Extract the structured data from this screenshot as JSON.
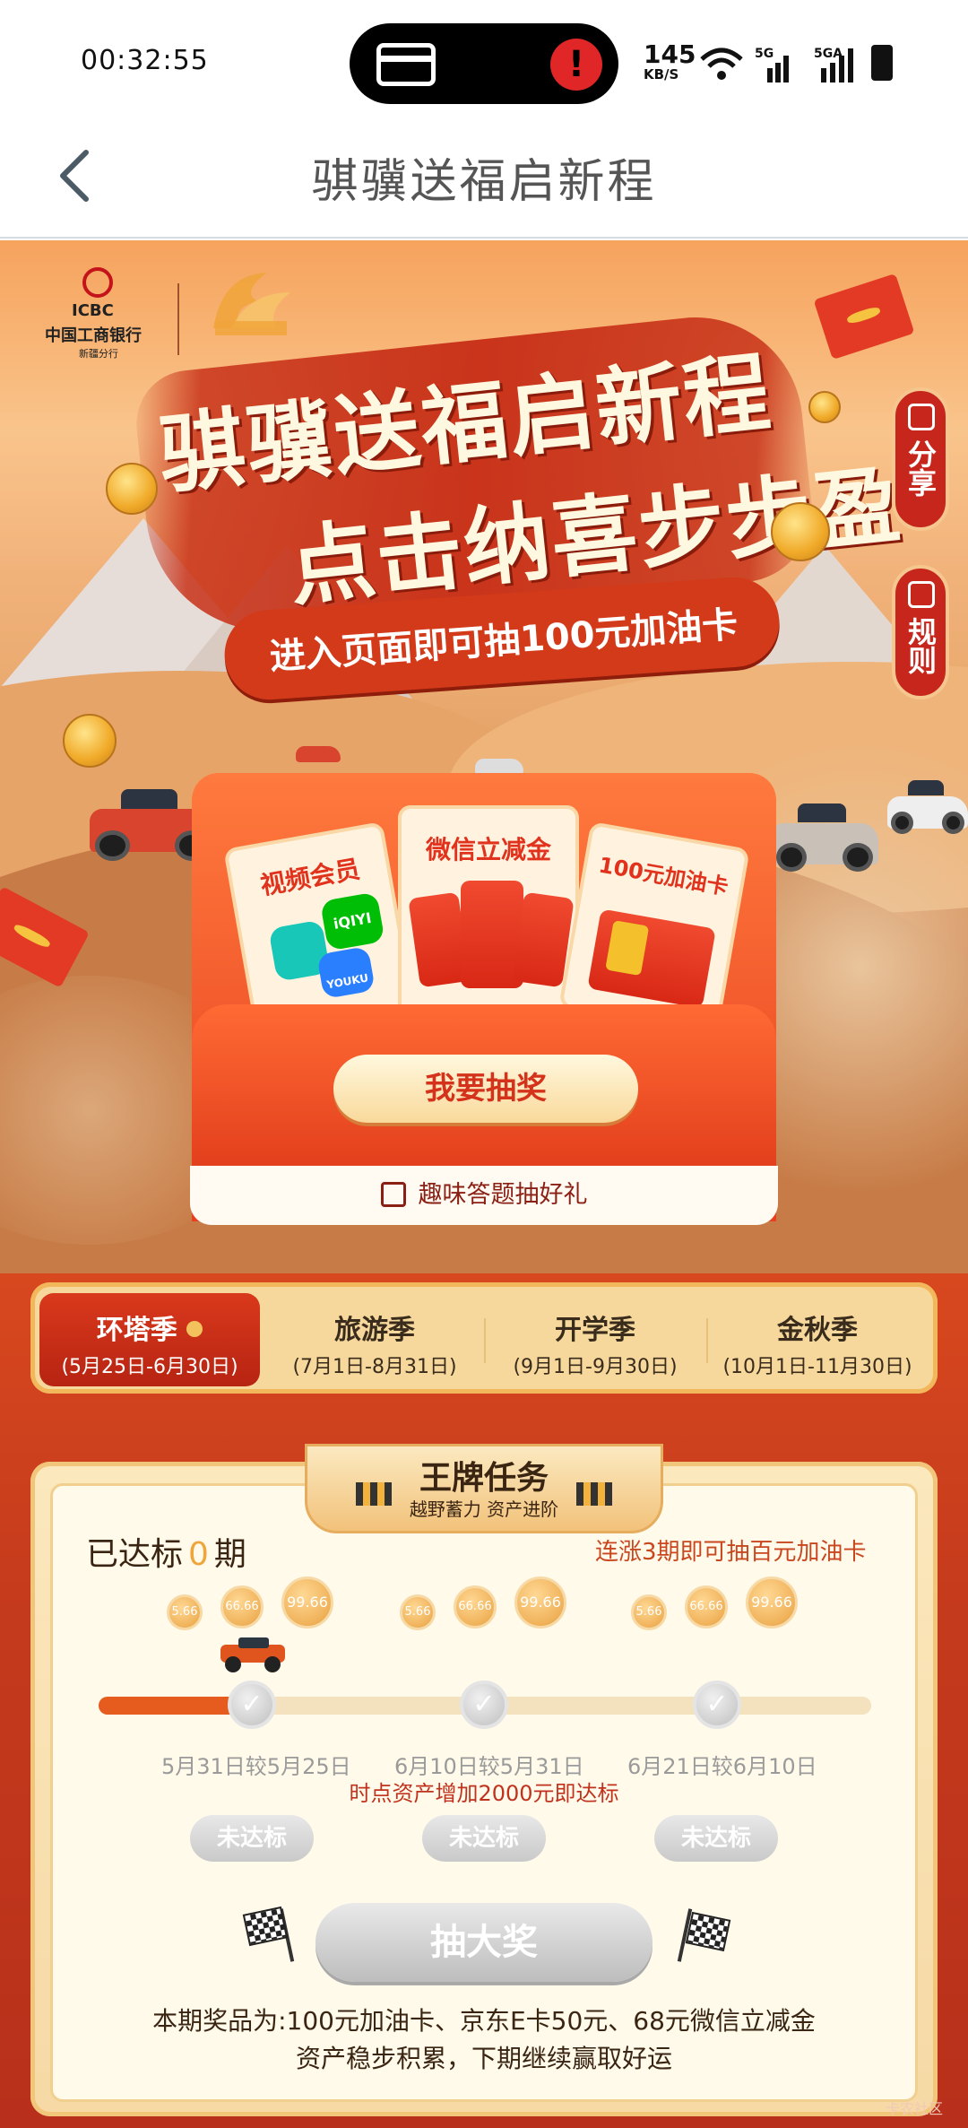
{
  "status": {
    "time": "00:32:55",
    "speed": "145",
    "speed_unit": "KB/S",
    "sig1": "5G",
    "sig2": "5GA"
  },
  "nav": {
    "title": "骐骥送福启新程"
  },
  "hero": {
    "bank_en": "ICBC",
    "bank_cn": "中国工商银行",
    "bank_branch": "新疆分行",
    "headline1": "骐骥送福启新程",
    "headline2": "点击纳喜步步盈",
    "ribbon": "进入页面即可抽100元加油卡",
    "share": "分享",
    "rules": "规则"
  },
  "prizes": {
    "ticket1": "视频会员",
    "ticket2": "微信立减金",
    "ticket3": "100元加油卡",
    "app1": "iQIYI",
    "app2": "YOUKU",
    "draw_button": "我要抽奖",
    "quiz_link": "趣味答题抽好礼"
  },
  "seasons": [
    {
      "name": "环塔季",
      "dates": "(5月25日-6月30日)"
    },
    {
      "name": "旅游季",
      "dates": "(7月1日-8月31日)"
    },
    {
      "name": "开学季",
      "dates": "(9月1日-9月30日)"
    },
    {
      "name": "金秋季",
      "dates": "(10月1日-11月30日)"
    }
  ],
  "task": {
    "title": "王牌任务",
    "subtitle": "越野蓄力  资产进阶",
    "achieved_prefix": "已达标",
    "achieved_count": "0",
    "achieved_suffix": "期",
    "tip": "连涨3期即可抽百元加油卡",
    "coins": [
      "5.66",
      "66.66",
      "99.66"
    ],
    "progress": 0.12,
    "stages": [
      {
        "date": "5月31日较5月25日",
        "status": "未达标"
      },
      {
        "date": "6月10日较5月31日",
        "status": "未达标"
      },
      {
        "date": "6月21日较6月10日",
        "status": "未达标"
      }
    ],
    "condition": "时点资产增加2000元即达标",
    "big_button": "抽大奖",
    "prize_note": "本期奖品为:100元加油卡、京东E卡50元、68元微信立减金",
    "prize_note2": "资产稳步积累，下期继续赢取好运"
  },
  "watermark": "卡农社区",
  "colors": {
    "accent": "#d9391c",
    "gold": "#f2c27a",
    "cream": "#fffaea"
  }
}
